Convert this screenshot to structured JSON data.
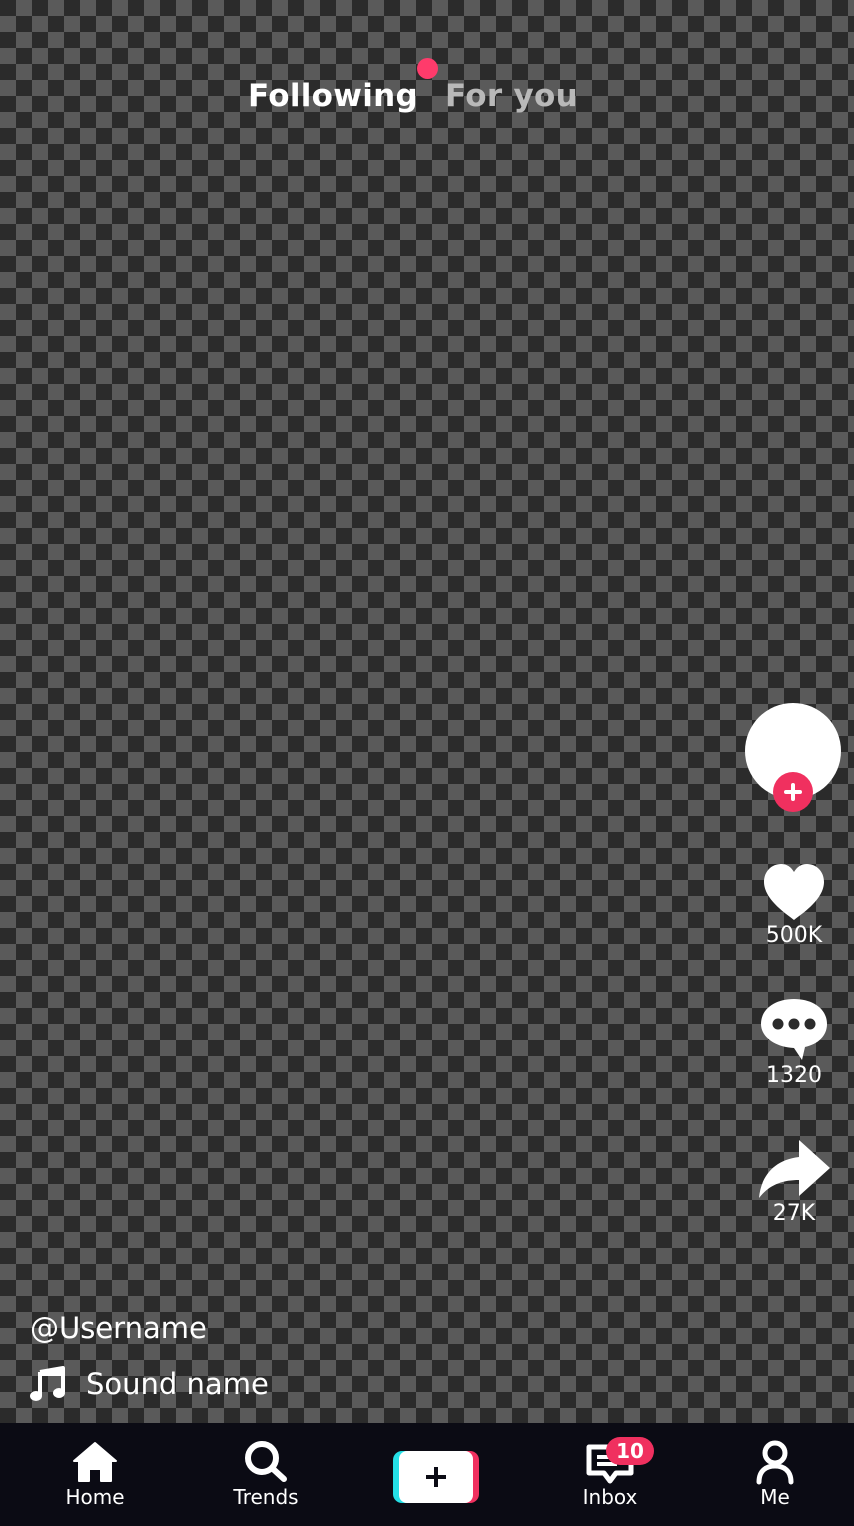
{
  "colors": {
    "accent_pink": "#f0305f",
    "accent_cyan": "#25e0e6",
    "nav_background": "#0b0b14",
    "tab_active": "#ffffff",
    "tab_inactive": "#b9b9b9"
  },
  "top_tabs": {
    "items": [
      {
        "label": "Following",
        "active": true
      },
      {
        "label": "For you",
        "active": false
      }
    ],
    "live_indicator": true
  },
  "actions": {
    "avatar": {
      "icon": "avatar-placeholder",
      "follow_icon": "plus-icon"
    },
    "like": {
      "icon": "heart-icon",
      "count": "500K"
    },
    "comment": {
      "icon": "comment-bubble-icon",
      "count": "1320"
    },
    "share": {
      "icon": "share-arrow-icon",
      "count": "27K"
    }
  },
  "caption": {
    "username": "@Username",
    "sound": {
      "icon": "music-note-icon",
      "label": "Sound name"
    }
  },
  "bottom_nav": {
    "items": [
      {
        "icon": "home-icon",
        "label": "Home",
        "active": true
      },
      {
        "icon": "search-icon",
        "label": "Trends"
      },
      {
        "icon": "create-plus-icon",
        "label": ""
      },
      {
        "icon": "inbox-icon",
        "label": "Inbox",
        "badge": "10"
      },
      {
        "icon": "profile-icon",
        "label": "Me"
      }
    ]
  }
}
